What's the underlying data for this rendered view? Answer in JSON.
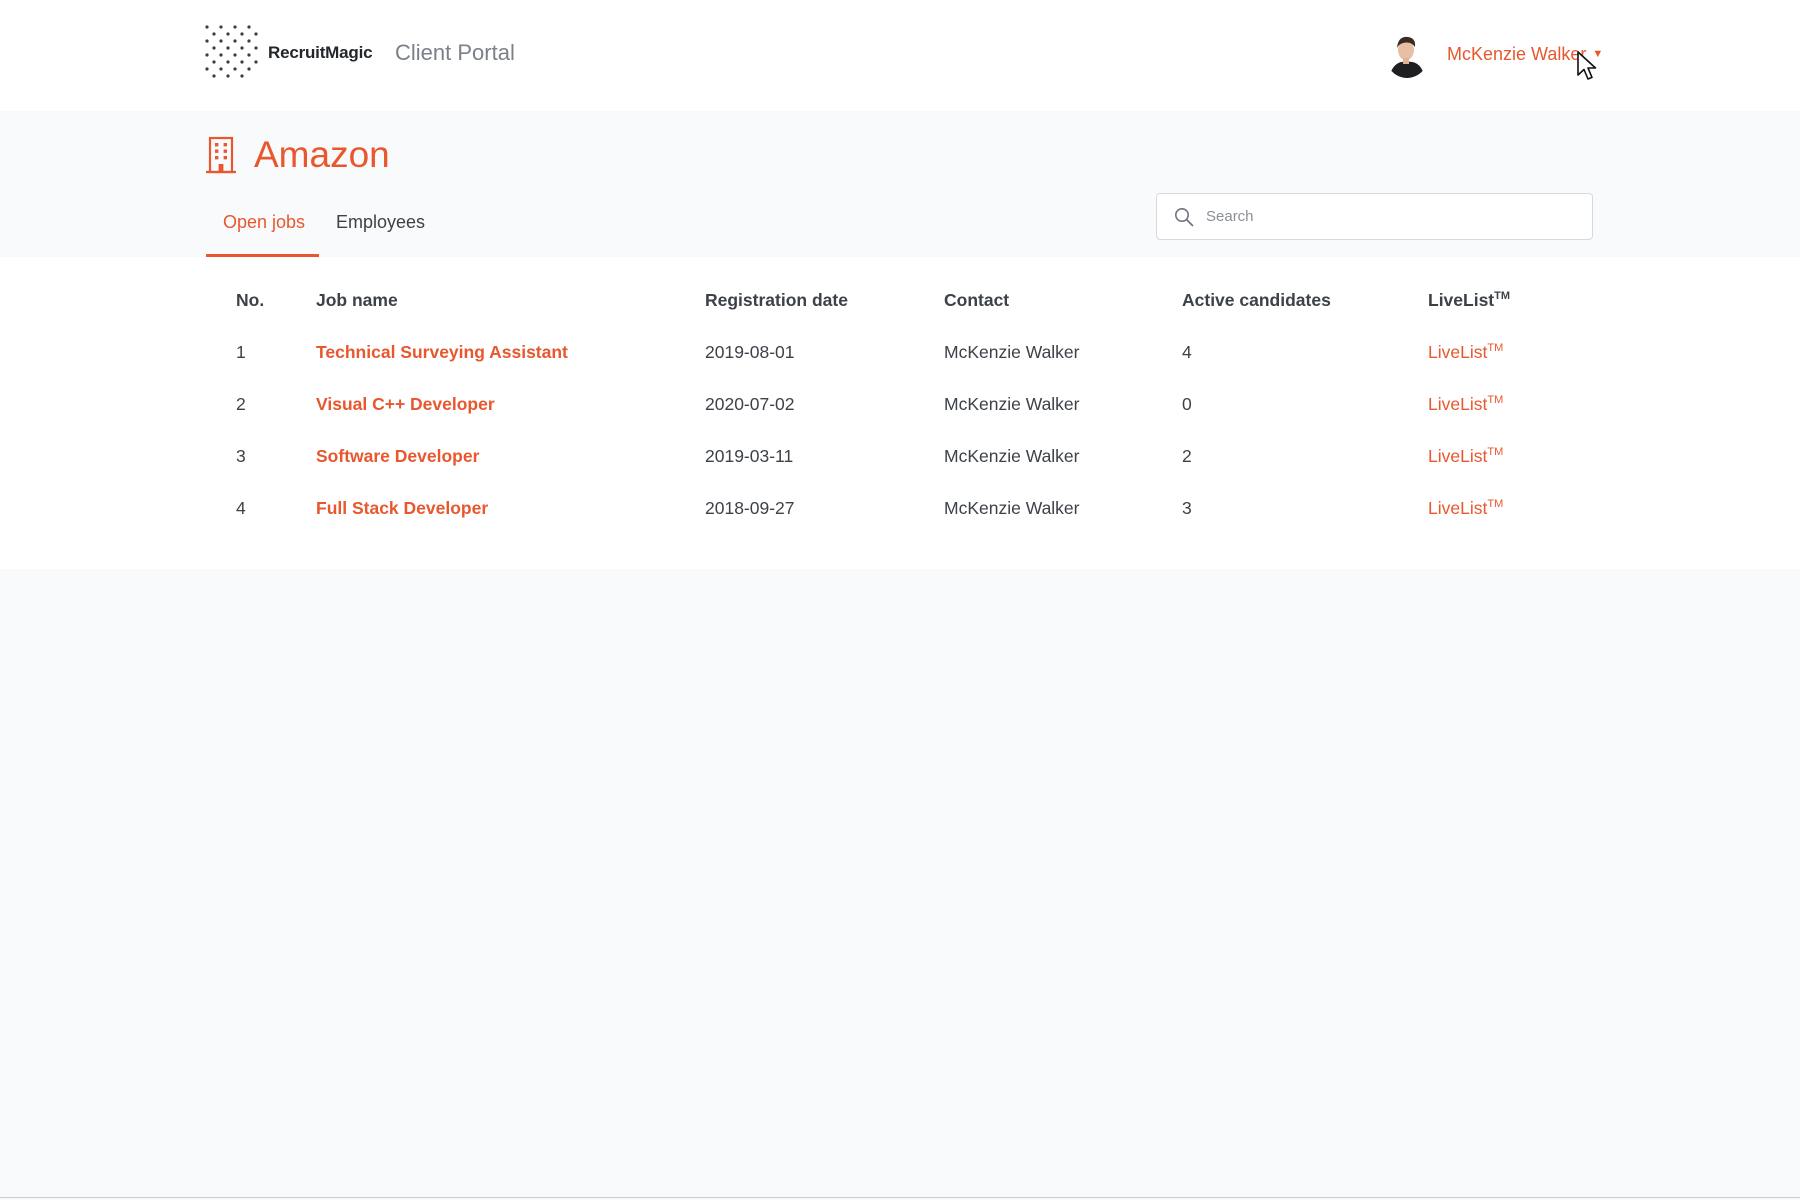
{
  "header": {
    "brand": "RecruitMagic",
    "portal_label": "Client Portal",
    "user_name": "McKenzie Walker"
  },
  "company": {
    "name": "Amazon"
  },
  "tabs": [
    {
      "label": "Open jobs",
      "active": true
    },
    {
      "label": "Employees",
      "active": false
    }
  ],
  "search": {
    "placeholder": "Search",
    "value": ""
  },
  "table": {
    "headers": {
      "no": "No.",
      "job": "Job name",
      "date": "Registration date",
      "contact": "Contact",
      "active": "Active candidates",
      "live": "LiveList",
      "live_sup": "TM"
    },
    "rows": [
      {
        "no": "1",
        "job": "Technical Surveying Assistant",
        "date": "2019-08-01",
        "contact": "McKenzie Walker",
        "active": "4",
        "live": "LiveList",
        "live_sup": "TM"
      },
      {
        "no": "2",
        "job": "Visual C++ Developer",
        "date": "2020-07-02",
        "contact": "McKenzie Walker",
        "active": "0",
        "live": "LiveList",
        "live_sup": "TM"
      },
      {
        "no": "3",
        "job": "Software Developer",
        "date": "2019-03-11",
        "contact": "McKenzie Walker",
        "active": "2",
        "live": "LiveList",
        "live_sup": "TM"
      },
      {
        "no": "4",
        "job": "Full Stack Developer",
        "date": "2018-09-27",
        "contact": "McKenzie Walker",
        "active": "3",
        "live": "LiveList",
        "live_sup": "TM"
      }
    ]
  },
  "colors": {
    "accent": "#e8572d",
    "text": "#3d4148",
    "page_bg": "#f9fafc"
  },
  "icons": {
    "logo": "dot-grid-logo-icon",
    "company": "office-building-icon",
    "search": "magnifier-icon",
    "user_menu": "chevron-down-icon"
  }
}
